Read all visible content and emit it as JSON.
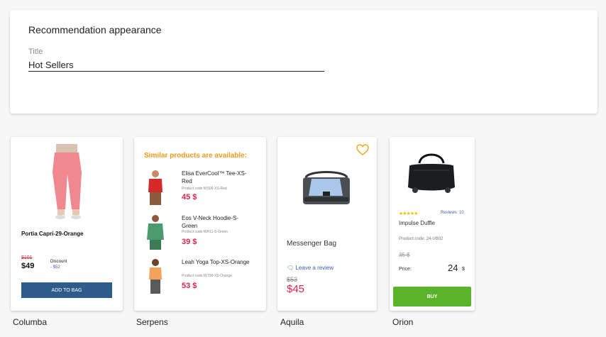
{
  "settings": {
    "title": "Recommendation appearance",
    "field_label": "Title",
    "field_value": "Hot Sellers"
  },
  "templates": {
    "columba": {
      "caption": "Columba",
      "product": "Portia Capri-29-Orange",
      "old_price": "$101",
      "price": "$49",
      "discount_label": "Discount",
      "discount_value": "- $52",
      "button": "ADD TO BAG"
    },
    "serpens": {
      "caption": "Serpens",
      "heading": "Similar products are available:",
      "items": [
        {
          "name": "Elisa EverCool™ Tee-XS-Red",
          "code": "Product code:WS06-XS-Red",
          "price": "45 $"
        },
        {
          "name": "Eos V-Neck Hoodie-S-Green",
          "code": "Product code:WH11-S-Green",
          "price": "39 $"
        },
        {
          "name": "Leah Yoga Top-XS-Orange",
          "code": "Product code:WT08-XS-Orange",
          "price": "53 $"
        }
      ]
    },
    "aquila": {
      "caption": "Aquila",
      "product": "Messenger Bag",
      "review": "Leave a review",
      "old_price": "$53",
      "price": "$45"
    },
    "orion": {
      "caption": "Orion",
      "stars": "★★★★★",
      "rating": 5,
      "reviews": "Reviews: 10",
      "product": "Impulse Duffle",
      "code": "Product code: 24-UB02",
      "old_price": "35 $",
      "price_label": "Price:",
      "price": "24",
      "currency": "$",
      "button": "BUY"
    }
  },
  "colors": {
    "accent_orange": "#f29a1b",
    "price_red": "#d9254b",
    "button_blue": "#2e5c8a",
    "button_green": "#5bb32a"
  }
}
